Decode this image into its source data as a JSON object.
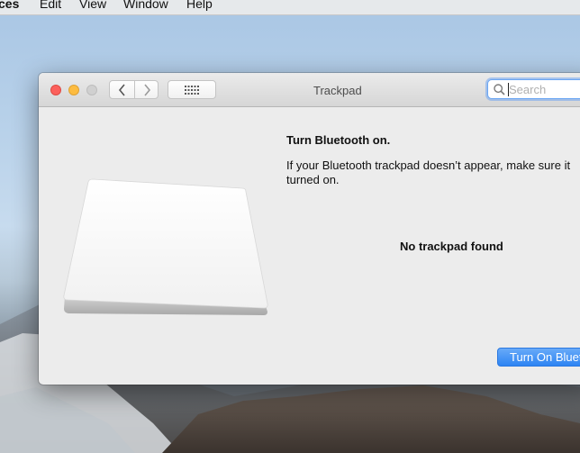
{
  "menubar": {
    "app_partial": "ces",
    "items": [
      "Edit",
      "View",
      "Window",
      "Help"
    ]
  },
  "window": {
    "title": "Trackpad",
    "search_placeholder": "Search",
    "heading": "Turn Bluetooth on.",
    "message_line1": "If your Bluetooth trackpad doesn’t appear, make sure it",
    "message_line2": "turned on.",
    "status": "No trackpad found",
    "button_label": "Turn On Bluetooth"
  },
  "colors": {
    "accent": "#2d84f3",
    "close": "#fc605c",
    "minimize": "#fdbc40"
  },
  "icons": [
    "back-chevron-icon",
    "forward-chevron-icon",
    "grid-icon",
    "search-icon",
    "trackpad-image"
  ]
}
